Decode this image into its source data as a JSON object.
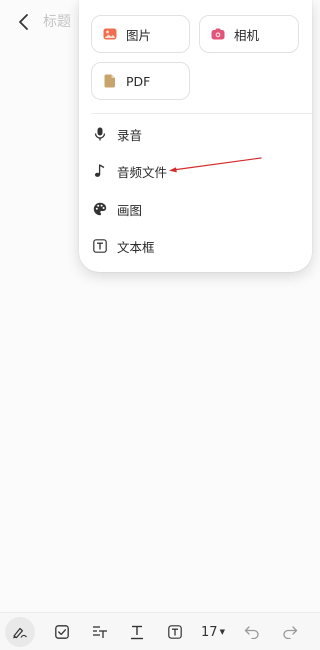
{
  "header": {
    "title_placeholder": "标题"
  },
  "popup": {
    "tiles": [
      {
        "label": "图片",
        "icon": "image-icon",
        "color": "#f06e4f"
      },
      {
        "label": "相机",
        "icon": "camera-icon",
        "color": "#e2557a"
      },
      {
        "label": "PDF",
        "icon": "pdf-file-icon",
        "color": "#c9a36c"
      }
    ],
    "items": [
      {
        "label": "录音",
        "icon": "microphone-icon"
      },
      {
        "label": "音频文件",
        "icon": "music-note-icon"
      },
      {
        "label": "画图",
        "icon": "palette-icon"
      },
      {
        "label": "文本框",
        "icon": "text-box-icon"
      }
    ],
    "annotation_color": "#d42b2b"
  },
  "toolbar": {
    "font_size": "17",
    "icons": [
      "pen-icon",
      "checkbox-icon",
      "text-size-icon",
      "underline-icon",
      "text-box-icon",
      "font-size-dropdown",
      "undo-icon",
      "redo-icon"
    ]
  }
}
